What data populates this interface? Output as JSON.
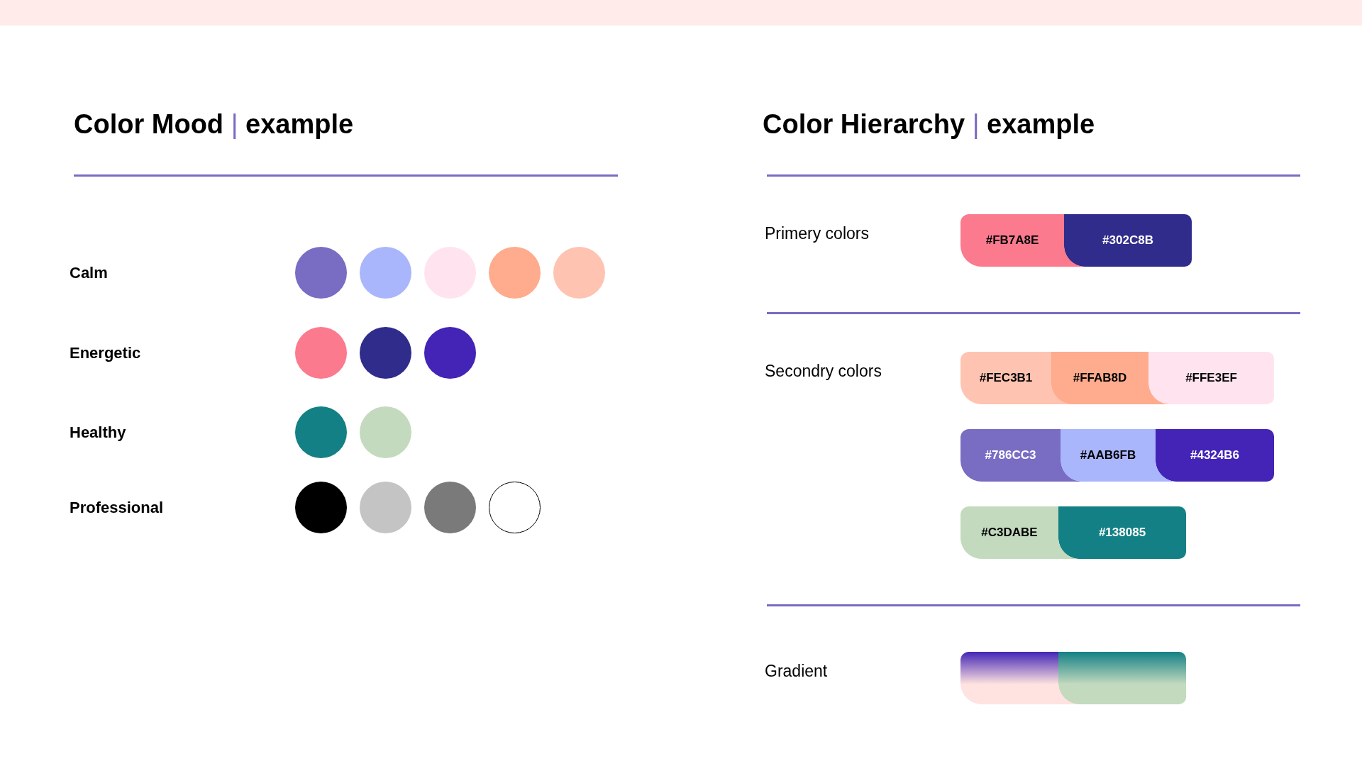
{
  "color_mood": {
    "title": "Color Mood",
    "separator": "|",
    "subtitle": "example",
    "rows": [
      {
        "label": "Calm",
        "swatches": [
          {
            "color": "#786cc3"
          },
          {
            "color": "#aab6fb"
          },
          {
            "color": "#ffe3ef"
          },
          {
            "color": "#ffab8d"
          },
          {
            "color": "#fec3b1"
          }
        ]
      },
      {
        "label": "Energetic",
        "swatches": [
          {
            "color": "#fb7a8e"
          },
          {
            "color": "#302c8b"
          },
          {
            "color": "#4324b6"
          }
        ]
      },
      {
        "label": "Healthy",
        "swatches": [
          {
            "color": "#138085"
          },
          {
            "color": "#c3dabe"
          }
        ]
      },
      {
        "label": "Professional",
        "swatches": [
          {
            "color": "#000000"
          },
          {
            "color": "#c4c4c4"
          },
          {
            "color": "#7a7a7a"
          },
          {
            "color": "#ffffff"
          }
        ]
      }
    ]
  },
  "color_hierarchy": {
    "title": "Color Hierarchy",
    "separator": "|",
    "subtitle": "example",
    "sections": [
      {
        "label": "Primery colors",
        "kind": "solid",
        "bars": [
          [
            {
              "hex": "#FB7A8E",
              "color": "#fb7a8e"
            },
            {
              "hex": "#302C8B",
              "color": "#302c8b"
            }
          ]
        ]
      },
      {
        "label": "Secondry colors",
        "kind": "solid",
        "bars": [
          [
            {
              "hex": "#FEC3B1",
              "color": "#fec3b1"
            },
            {
              "hex": "#FFAB8D",
              "color": "#ffab8d"
            },
            {
              "hex": "#FFE3EF",
              "color": "#ffe3ef"
            }
          ],
          [
            {
              "hex": "#786CC3",
              "color": "#786cc3"
            },
            {
              "hex": "#AAB6FB",
              "color": "#aab6fb"
            },
            {
              "hex": "#4324B6",
              "color": "#4324b6"
            }
          ],
          [
            {
              "hex": "#C3DABE",
              "color": "#c3dabe"
            },
            {
              "hex": "#138085",
              "color": "#138085"
            }
          ]
        ]
      },
      {
        "label": "Gradient",
        "kind": "gradient",
        "bars": [
          [
            {
              "stops": [
                {
                  "color": "#4324b6"
                },
                {
                  "color": "#ffe3e0"
                }
              ]
            },
            {
              "stops": [
                {
                  "color": "#138085"
                },
                {
                  "color": "#c3dabe"
                }
              ]
            }
          ]
        ]
      }
    ]
  }
}
